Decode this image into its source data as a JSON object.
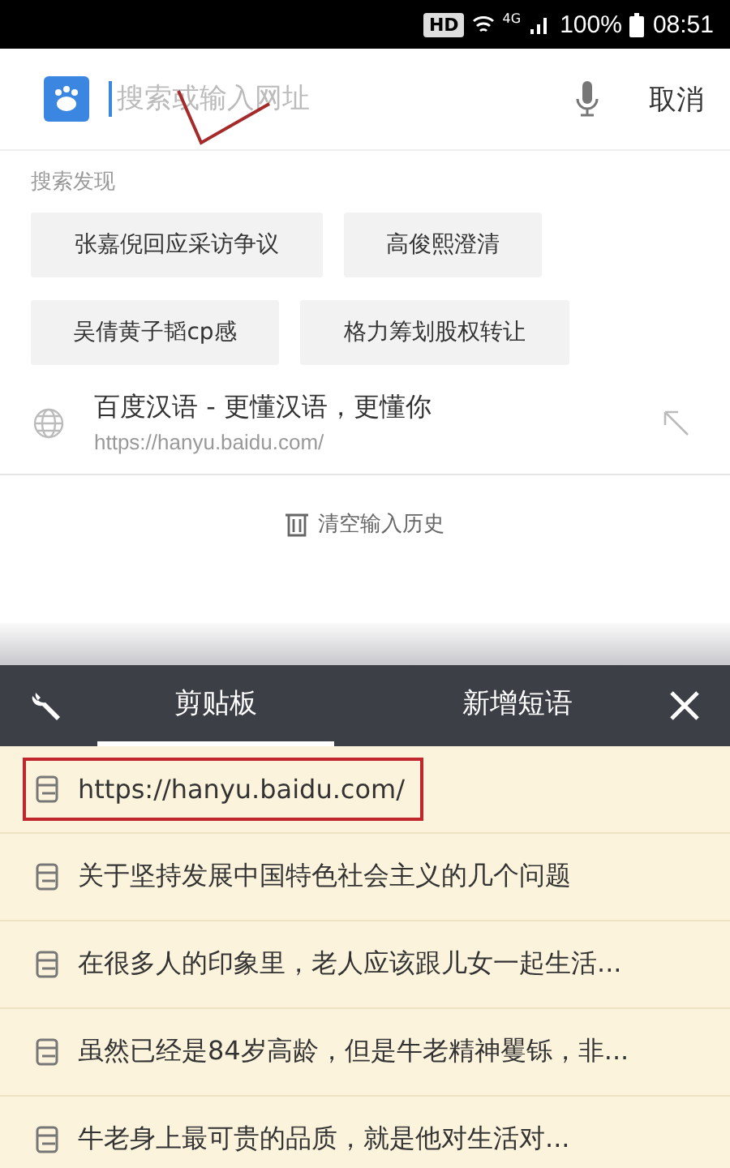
{
  "status_bar": {
    "badge": "HD",
    "network": "4G",
    "battery_text": "100%",
    "time": "08:51"
  },
  "search": {
    "placeholder": "搜索或输入网址",
    "cancel": "取消"
  },
  "discover": {
    "title": "搜索发现",
    "chips": [
      {
        "label": "张嘉倪回应采访争议"
      },
      {
        "label": "高俊熙澄清"
      },
      {
        "label": "吴倩黄子韬cp感"
      },
      {
        "label": "格力筹划股权转让"
      }
    ]
  },
  "suggestion": {
    "title": "百度汉语 - 更懂汉语，更懂你",
    "url": "https://hanyu.baidu.com/"
  },
  "clear_history": "清空输入历史",
  "keyboard_toolbar": {
    "tabs": [
      {
        "label": "剪贴板",
        "selected": true
      },
      {
        "label": "新增短语",
        "selected": false
      }
    ]
  },
  "clipboard": [
    {
      "text": "https://hanyu.baidu.com/",
      "highlighted": true
    },
    {
      "text": "关于坚持发展中国特色社会主义的几个问题",
      "highlighted": false
    },
    {
      "text": "在很多人的印象里，老人应该跟儿女一起生活...",
      "highlighted": false
    },
    {
      "text": "虽然已经是84岁高龄，但是牛老精神矍铄，非...",
      "highlighted": false
    },
    {
      "text": "牛老身上最可贵的品质，就是他对生活对...",
      "highlighted": false
    }
  ]
}
